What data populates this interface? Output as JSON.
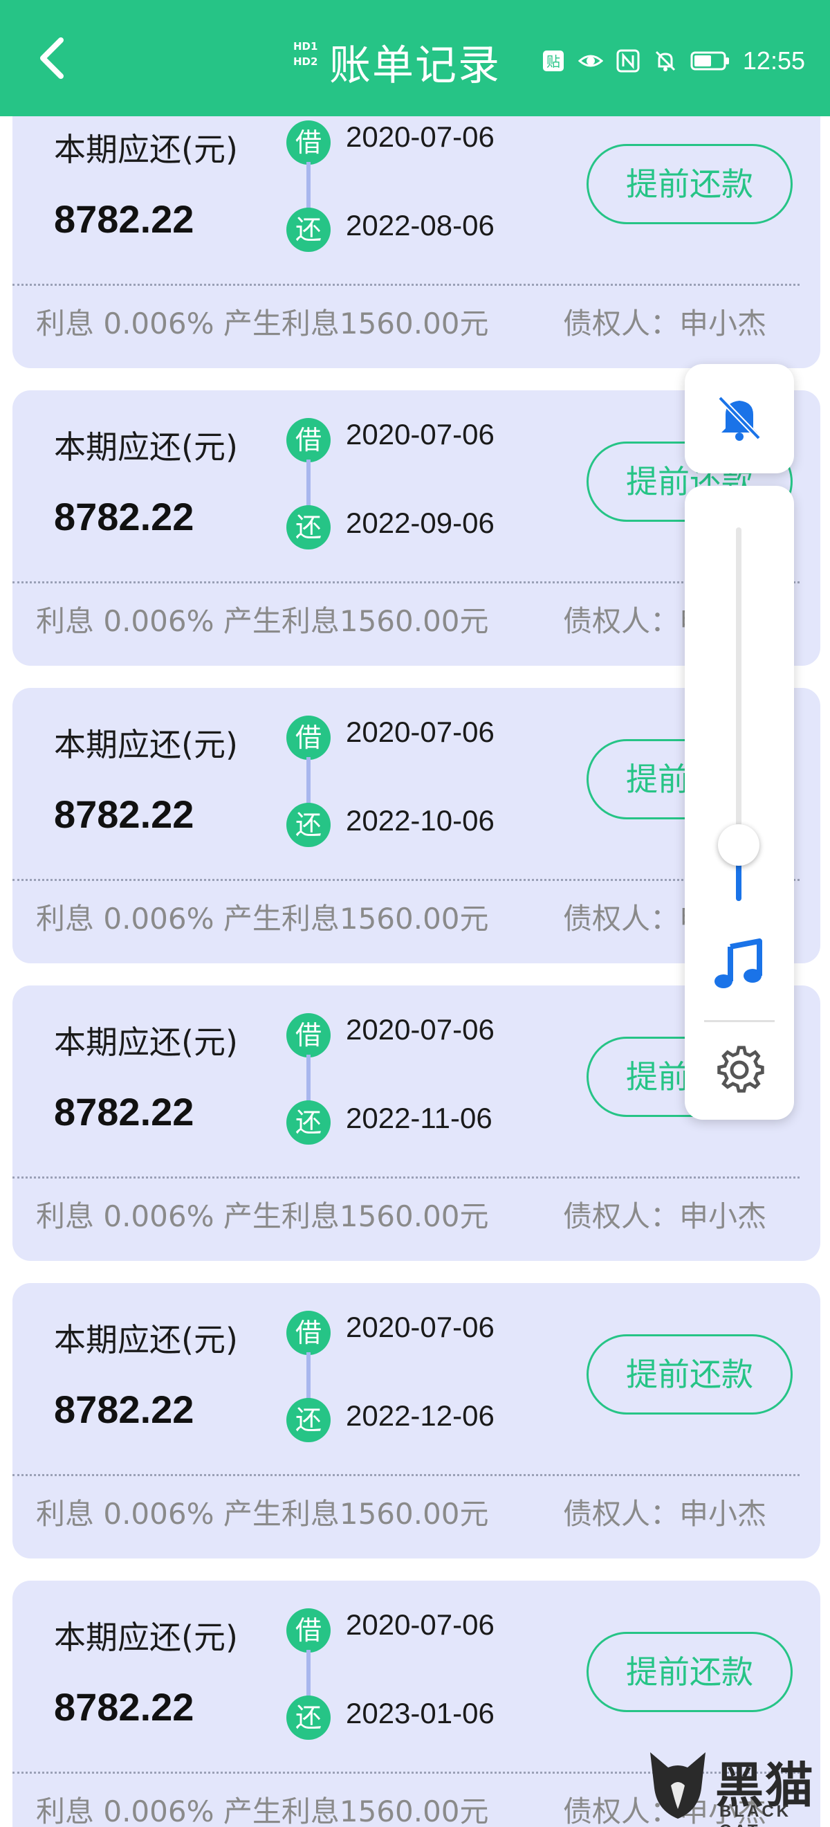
{
  "header": {
    "title": "账单记录",
    "status": {
      "hd_top": "HD1",
      "hd_bottom": "HD2",
      "time": "12:55",
      "icons": [
        "hd-signal-icon",
        "paste-icon",
        "eye-icon",
        "nfc-icon",
        "mute-icon",
        "battery-icon"
      ],
      "paste_label": "贴"
    },
    "back_icon": "back-arrow-icon"
  },
  "bills": [
    {
      "label": "本期应还(元)",
      "amount": "8782.22",
      "borrow_badge": "借",
      "borrow_date": "2020-07-06",
      "repay_badge": "还",
      "repay_date": "2022-08-06",
      "button": "提前还款",
      "interest": "利息 0.006%  产生利息1560.00元",
      "creditor": "债权人：申小杰"
    },
    {
      "label": "本期应还(元)",
      "amount": "8782.22",
      "borrow_badge": "借",
      "borrow_date": "2020-07-06",
      "repay_badge": "还",
      "repay_date": "2022-09-06",
      "button": "提前还款",
      "interest": "利息 0.006%  产生利息1560.00元",
      "creditor": "债权人：申小杰"
    },
    {
      "label": "本期应还(元)",
      "amount": "8782.22",
      "borrow_badge": "借",
      "borrow_date": "2020-07-06",
      "repay_badge": "还",
      "repay_date": "2022-10-06",
      "button": "提前还款",
      "interest": "利息 0.006%  产生利息1560.00元",
      "creditor": "债权人：申小杰"
    },
    {
      "label": "本期应还(元)",
      "amount": "8782.22",
      "borrow_badge": "借",
      "borrow_date": "2020-07-06",
      "repay_badge": "还",
      "repay_date": "2022-11-06",
      "button": "提前还款",
      "interest": "利息 0.006%  产生利息1560.00元",
      "creditor": "债权人：申小杰"
    },
    {
      "label": "本期应还(元)",
      "amount": "8782.22",
      "borrow_badge": "借",
      "borrow_date": "2020-07-06",
      "repay_badge": "还",
      "repay_date": "2022-12-06",
      "button": "提前还款",
      "interest": "利息 0.006%  产生利息1560.00元",
      "creditor": "债权人：申小杰"
    },
    {
      "label": "本期应还(元)",
      "amount": "8782.22",
      "borrow_badge": "借",
      "borrow_date": "2020-07-06",
      "repay_badge": "还",
      "repay_date": "2023-01-06",
      "button": "提前还款",
      "interest": "利息 0.006%  产生利息1560.00元",
      "creditor": "债权人：申小杰"
    }
  ],
  "volume_overlay": {
    "mute_icon": "bell-off-icon",
    "level_fraction": 0.15,
    "music_icon": "music-note-icon",
    "settings_icon": "gear-icon"
  },
  "watermark": {
    "cn": "黑猫",
    "en": "BLACK CAT"
  },
  "colors": {
    "accent": "#26c486",
    "card_bg": "#e3e6fb",
    "slider_fill": "#1a73e8",
    "muted_text": "#8a8a8a"
  }
}
